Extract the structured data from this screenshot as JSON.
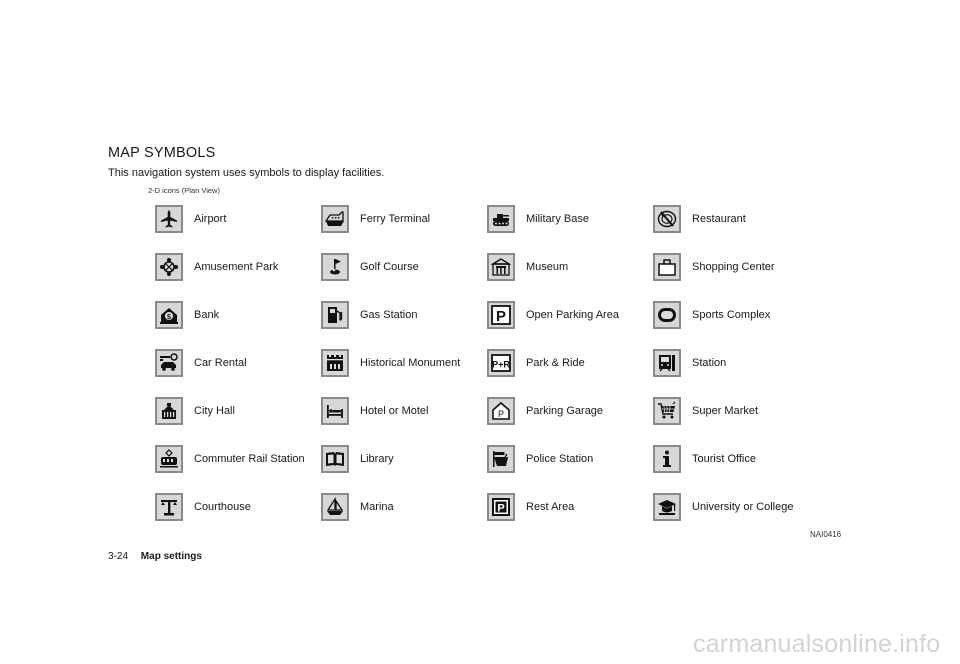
{
  "heading": {
    "title": "MAP SYMBOLS",
    "intro": "This navigation system uses symbols to display facilities.",
    "caption": "2-D icons (Plan View)"
  },
  "columns": [
    {
      "items": [
        {
          "label": "Airport",
          "icon": "airplane-icon"
        },
        {
          "label": "Amusement Park",
          "icon": "ferris-wheel-icon"
        },
        {
          "label": "Bank",
          "icon": "dollar-icon"
        },
        {
          "label": "Car Rental",
          "icon": "car-key-icon"
        },
        {
          "label": "City Hall",
          "icon": "city-hall-icon"
        },
        {
          "label": "Commuter Rail Station",
          "icon": "tram-icon"
        },
        {
          "label": "Courthouse",
          "icon": "scales-icon"
        }
      ]
    },
    {
      "items": [
        {
          "label": "Ferry Terminal",
          "icon": "ferry-icon"
        },
        {
          "label": "Golf Course",
          "icon": "golf-flag-icon"
        },
        {
          "label": "Gas Station",
          "icon": "fuel-pump-icon"
        },
        {
          "label": "Historical Monument",
          "icon": "castle-icon"
        },
        {
          "label": "Hotel or Motel",
          "icon": "bed-icon"
        },
        {
          "label": "Library",
          "icon": "book-icon"
        },
        {
          "label": "Marina",
          "icon": "sailboat-icon"
        }
      ]
    },
    {
      "items": [
        {
          "label": "Military Base",
          "icon": "tank-icon"
        },
        {
          "label": "Museum",
          "icon": "museum-icon"
        },
        {
          "label": "Open Parking Area",
          "icon": "parking-icon"
        },
        {
          "label": "Park & Ride",
          "icon": "park-and-ride-icon"
        },
        {
          "label": "Parking Garage",
          "icon": "parking-garage-icon"
        },
        {
          "label": "Police Station",
          "icon": "police-icon"
        },
        {
          "label": "Rest Area",
          "icon": "rest-area-icon"
        }
      ]
    },
    {
      "items": [
        {
          "label": "Restaurant",
          "icon": "restaurant-icon"
        },
        {
          "label": "Shopping Center",
          "icon": "shopping-bag-icon"
        },
        {
          "label": "Sports Complex",
          "icon": "stadium-icon"
        },
        {
          "label": "Station",
          "icon": "train-station-icon"
        },
        {
          "label": "Super Market",
          "icon": "shopping-cart-icon"
        },
        {
          "label": "Tourist Office",
          "icon": "info-icon"
        },
        {
          "label": "University or College",
          "icon": "graduation-cap-icon"
        }
      ]
    }
  ],
  "figure_code": "NAI0416",
  "footer": {
    "page_number": "3-24",
    "section": "Map settings"
  },
  "watermark": "carmanualsonline.info"
}
